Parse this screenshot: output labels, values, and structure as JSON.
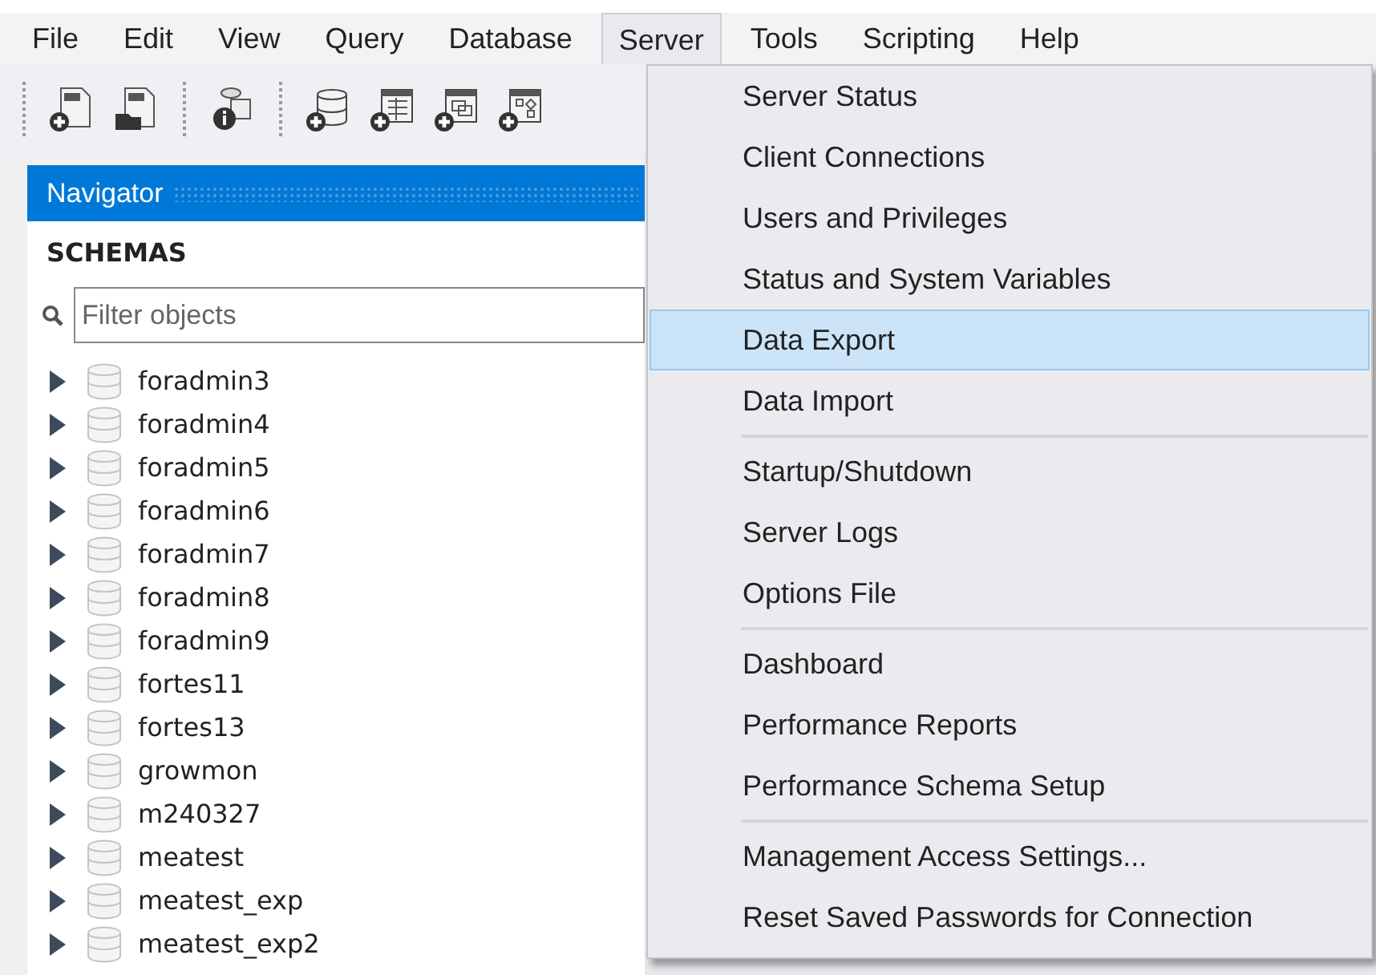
{
  "menu_bar": [
    {
      "label": "File",
      "selected": false
    },
    {
      "label": "Edit",
      "selected": false
    },
    {
      "label": "View",
      "selected": false
    },
    {
      "label": "Query",
      "selected": false
    },
    {
      "label": "Database",
      "selected": false
    },
    {
      "label": "Server",
      "selected": true
    },
    {
      "label": "Tools",
      "selected": false
    },
    {
      "label": "Scripting",
      "selected": false
    },
    {
      "label": "Help",
      "selected": false
    }
  ],
  "navigator": {
    "title": "Navigator",
    "section": "SCHEMAS",
    "filter": {
      "placeholder": "Filter objects"
    },
    "schemas": [
      {
        "name": "foradmin3",
        "expanded": false
      },
      {
        "name": "foradmin4",
        "expanded": false
      },
      {
        "name": "foradmin5",
        "expanded": false
      },
      {
        "name": "foradmin6",
        "expanded": false
      },
      {
        "name": "foradmin7",
        "expanded": false
      },
      {
        "name": "foradmin8",
        "expanded": false
      },
      {
        "name": "foradmin9",
        "expanded": false
      },
      {
        "name": "fortes11",
        "expanded": false
      },
      {
        "name": "fortes13",
        "expanded": false
      },
      {
        "name": "growmon",
        "expanded": false
      },
      {
        "name": "m240327",
        "expanded": false
      },
      {
        "name": "meatest",
        "expanded": false
      },
      {
        "name": "meatest_exp",
        "expanded": false
      },
      {
        "name": "meatest_exp2",
        "expanded": false
      }
    ]
  },
  "server_menu": [
    {
      "kind": "item",
      "label": "Server Status",
      "selected": false
    },
    {
      "kind": "item",
      "label": "Client Connections",
      "selected": false
    },
    {
      "kind": "item",
      "label": "Users and Privileges",
      "selected": false
    },
    {
      "kind": "item",
      "label": "Status and System Variables",
      "selected": false
    },
    {
      "kind": "item",
      "label": "Data Export",
      "selected": true
    },
    {
      "kind": "item",
      "label": "Data Import",
      "selected": false
    },
    {
      "kind": "separator"
    },
    {
      "kind": "item",
      "label": "Startup/Shutdown",
      "selected": false
    },
    {
      "kind": "item",
      "label": "Server Logs",
      "selected": false
    },
    {
      "kind": "item",
      "label": "Options File",
      "selected": false
    },
    {
      "kind": "separator"
    },
    {
      "kind": "item",
      "label": "Dashboard",
      "selected": false
    },
    {
      "kind": "item",
      "label": "Performance Reports",
      "selected": false
    },
    {
      "kind": "item",
      "label": "Performance Schema Setup",
      "selected": false
    },
    {
      "kind": "separator"
    },
    {
      "kind": "item",
      "label": "Management Access Settings...",
      "selected": false
    },
    {
      "kind": "item",
      "label": "Reset Saved Passwords for Connection",
      "selected": false
    }
  ]
}
